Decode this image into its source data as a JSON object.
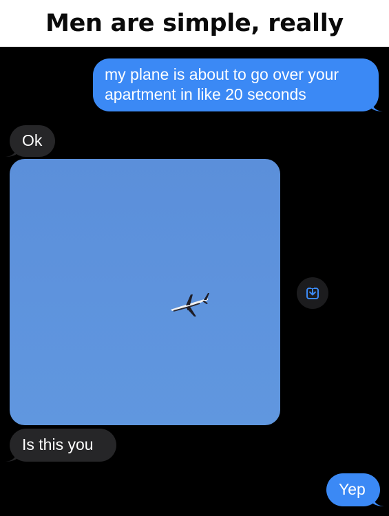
{
  "caption": {
    "title": "Men are simple, really"
  },
  "conversation": {
    "messages": [
      {
        "direction": "sent",
        "text": "my plane is about to go over your apartment in like 20 seconds"
      },
      {
        "direction": "received",
        "text": "Ok"
      },
      {
        "direction": "received",
        "type": "image",
        "image_description": "airplane in blue sky"
      },
      {
        "direction": "received",
        "text": "Is this you"
      },
      {
        "direction": "sent",
        "text": "Yep"
      }
    ],
    "save_button_icon": "save-to-photos-icon"
  },
  "colors": {
    "sent_bubble": "#3b89f5",
    "received_bubble": "#262628",
    "background": "#000000",
    "sky": "#5e93dd"
  }
}
